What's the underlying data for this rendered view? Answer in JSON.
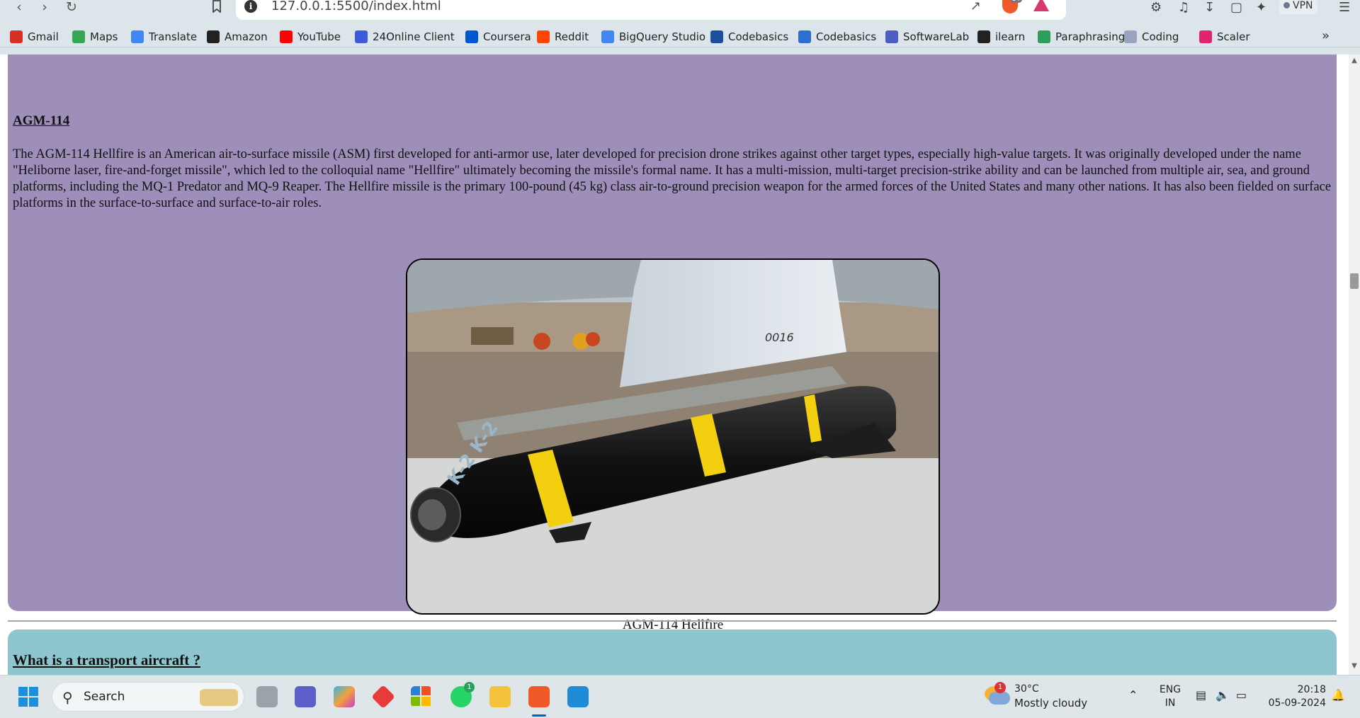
{
  "browser": {
    "url": "127.0.0.1:5500/index.html",
    "brave_badge": "14",
    "vpn_label": "VPN"
  },
  "bookmarks": [
    {
      "label": "Gmail",
      "icon": "gmail-icon",
      "color": "#d93025"
    },
    {
      "label": "Maps",
      "icon": "maps-icon",
      "color": "#34a853"
    },
    {
      "label": "Translate",
      "icon": "translate-icon",
      "color": "#4285f4"
    },
    {
      "label": "Amazon",
      "icon": "amazon-icon",
      "color": "#222222"
    },
    {
      "label": "YouTube",
      "icon": "youtube-icon",
      "color": "#ff0000"
    },
    {
      "label": "24Online Client",
      "icon": "24online-icon",
      "color": "#3b5bdb"
    },
    {
      "label": "Coursera",
      "icon": "coursera-icon",
      "color": "#0056d2"
    },
    {
      "label": "Reddit",
      "icon": "reddit-icon",
      "color": "#ff4500"
    },
    {
      "label": "BigQuery Studio",
      "icon": "bigquery-icon",
      "color": "#4285f4"
    },
    {
      "label": "Codebasics",
      "icon": "rocket-icon",
      "color": "#1b4f9c"
    },
    {
      "label": "Codebasics",
      "icon": "codebasics-icon",
      "color": "#2c6fd1"
    },
    {
      "label": "SoftwareLab",
      "icon": "softwarelab-icon",
      "color": "#4a5fc1"
    },
    {
      "label": "ilearn",
      "icon": "ilearn-icon",
      "color": "#222222"
    },
    {
      "label": "Paraphrasing",
      "icon": "paraphrasing-icon",
      "color": "#2e9e5b"
    },
    {
      "label": "Coding",
      "icon": "coding-icon",
      "color": "#9aa4c0"
    },
    {
      "label": "Scaler",
      "icon": "scaler-icon",
      "color": "#e0246f"
    }
  ],
  "content": {
    "section_title": "AGM-114",
    "paragraph": "The AGM-114 Hellfire is an American air-to-surface missile (ASM) first developed for anti-armor use, later developed for precision drone strikes against other target types, especially high-value targets. It was originally developed under the name \"Heliborne laser, fire-and-forget missile\", which led to the colloquial name \"Hellfire\" ultimately becoming the missile's formal name. It has a multi-mission, multi-target precision-strike ability and can be launched from multiple air, sea, and ground platforms, including the MQ-1 Predator and MQ-9 Reaper. The Hellfire missile is the primary 100-pound (45 kg) class air-to-ground precision weapon for the armed forces of the United States and many other nations. It has also been fielded on surface platforms in the surface-to-surface and surface-to-air roles.",
    "image_caption": "AGM-114 Hellfire",
    "image_markings": {
      "pylon_number": "0016",
      "nose": "K-2 K-2"
    },
    "next_section_title": "What is a transport aircraft ?",
    "card_colors": {
      "section1": "#9d8fba",
      "section2": "#8ec6ce"
    }
  },
  "taskbar": {
    "search_label": "Search",
    "whatsapp_badge": "1",
    "weather_badge": "1",
    "temperature": "30°C",
    "condition": "Mostly cloudy",
    "language_1": "ENG",
    "language_2": "IN",
    "time": "20:18",
    "date": "05-09-2024"
  }
}
